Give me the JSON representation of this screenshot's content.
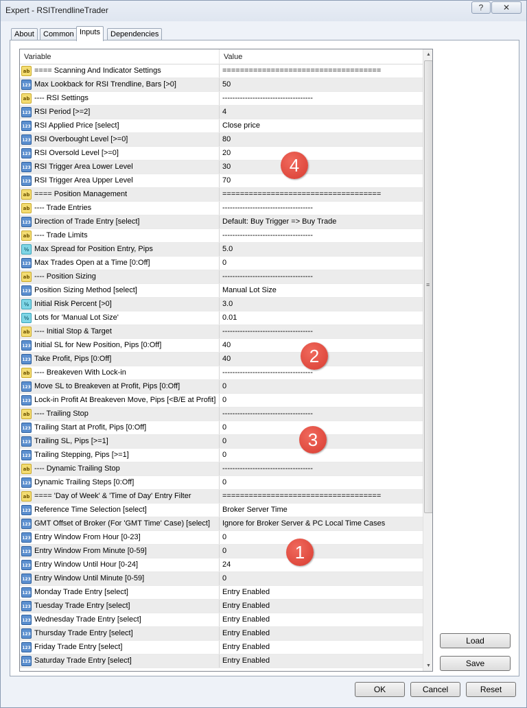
{
  "window": {
    "title": "Expert - RSITrendlineTrader",
    "help_label": "?",
    "close_label": "✕"
  },
  "tabs": [
    {
      "label": "About",
      "active": false
    },
    {
      "label": "Common",
      "active": false
    },
    {
      "label": "Inputs",
      "active": true
    },
    {
      "label": "Dependencies",
      "active": false
    }
  ],
  "grid": {
    "columns": {
      "variable": "Variable",
      "value": "Value"
    },
    "rows": [
      {
        "icon": "ab",
        "variable": "==== Scanning And Indicator Settings",
        "value": "===================================="
      },
      {
        "icon": "123",
        "variable": "Max Lookback for RSI Trendline, Bars [>0]",
        "value": "50"
      },
      {
        "icon": "ab",
        "variable": "---- RSI Settings",
        "value": "------------------------------------"
      },
      {
        "icon": "123",
        "variable": "RSI Period [>=2]",
        "value": "4"
      },
      {
        "icon": "123",
        "variable": "RSI Applied Price [select]",
        "value": "Close price"
      },
      {
        "icon": "123",
        "variable": "RSI Overbought Level [>=0]",
        "value": "80"
      },
      {
        "icon": "123",
        "variable": "RSI Oversold Level [>=0]",
        "value": "20"
      },
      {
        "icon": "123",
        "variable": "RSI Trigger Area Lower Level",
        "value": "30"
      },
      {
        "icon": "123",
        "variable": "RSI Trigger Area Upper Level",
        "value": "70"
      },
      {
        "icon": "ab",
        "variable": "==== Position Management",
        "value": "===================================="
      },
      {
        "icon": "ab",
        "variable": "---- Trade Entries",
        "value": "------------------------------------"
      },
      {
        "icon": "123",
        "variable": "Direction of Trade Entry [select]",
        "value": "Default: Buy Trigger => Buy Trade"
      },
      {
        "icon": "ab",
        "variable": "---- Trade Limits",
        "value": "------------------------------------"
      },
      {
        "icon": "half",
        "variable": "Max Spread for Position Entry, Pips",
        "value": "5.0"
      },
      {
        "icon": "123",
        "variable": "Max Trades Open at a Time [0:Off]",
        "value": "0"
      },
      {
        "icon": "ab",
        "variable": "---- Position Sizing",
        "value": "------------------------------------"
      },
      {
        "icon": "123",
        "variable": "Position Sizing Method [select]",
        "value": "Manual Lot Size"
      },
      {
        "icon": "half",
        "variable": "Initial Risk Percent [>0]",
        "value": "3.0"
      },
      {
        "icon": "half",
        "variable": "Lots for 'Manual Lot Size'",
        "value": "0.01"
      },
      {
        "icon": "ab",
        "variable": "---- Initial Stop & Target",
        "value": "------------------------------------"
      },
      {
        "icon": "123",
        "variable": "Initial SL for New Position, Pips [0:Off]",
        "value": "40"
      },
      {
        "icon": "123",
        "variable": "Take Profit, Pips [0:Off]",
        "value": "40"
      },
      {
        "icon": "ab",
        "variable": "---- Breakeven With Lock-in",
        "value": "------------------------------------"
      },
      {
        "icon": "123",
        "variable": "Move SL to Breakeven at Profit, Pips [0:Off]",
        "value": "0"
      },
      {
        "icon": "123",
        "variable": "Lock-in Profit At Breakeven Move, Pips [<B/E at Profit]",
        "value": "0"
      },
      {
        "icon": "ab",
        "variable": "---- Trailing Stop",
        "value": "------------------------------------"
      },
      {
        "icon": "123",
        "variable": "Trailing Start at Profit, Pips [0:Off]",
        "value": "0"
      },
      {
        "icon": "123",
        "variable": "Trailing SL, Pips [>=1]",
        "value": "0"
      },
      {
        "icon": "123",
        "variable": "Trailing Stepping, Pips [>=1]",
        "value": "0"
      },
      {
        "icon": "ab",
        "variable": "---- Dynamic Trailing Stop",
        "value": "------------------------------------"
      },
      {
        "icon": "123",
        "variable": "Dynamic Trailing Steps [0:Off]",
        "value": "0"
      },
      {
        "icon": "ab",
        "variable": "==== 'Day of Week' & 'Time of Day' Entry Filter",
        "value": "===================================="
      },
      {
        "icon": "123",
        "variable": "Reference Time Selection [select]",
        "value": "Broker Server Time"
      },
      {
        "icon": "123",
        "variable": "GMT Offset of Broker (For 'GMT Time' Case) [select]",
        "value": "Ignore for Broker Server & PC Local Time Cases"
      },
      {
        "icon": "123",
        "variable": "Entry Window From Hour [0-23]",
        "value": "0"
      },
      {
        "icon": "123",
        "variable": "Entry Window From Minute [0-59]",
        "value": "0"
      },
      {
        "icon": "123",
        "variable": "Entry Window Until Hour [0-24]",
        "value": "24"
      },
      {
        "icon": "123",
        "variable": "Entry Window Until Minute [0-59]",
        "value": "0"
      },
      {
        "icon": "123",
        "variable": "Monday Trade Entry [select]",
        "value": "Entry Enabled"
      },
      {
        "icon": "123",
        "variable": "Tuesday Trade Entry [select]",
        "value": "Entry Enabled"
      },
      {
        "icon": "123",
        "variable": "Wednesday Trade Entry [select]",
        "value": "Entry Enabled"
      },
      {
        "icon": "123",
        "variable": "Thursday Trade Entry [select]",
        "value": "Entry Enabled"
      },
      {
        "icon": "123",
        "variable": "Friday Trade Entry [select]",
        "value": "Entry Enabled"
      },
      {
        "icon": "123",
        "variable": "Saturday Trade Entry [select]",
        "value": "Entry Enabled"
      }
    ]
  },
  "annotations": [
    {
      "label": "4"
    },
    {
      "label": "2"
    },
    {
      "label": "3"
    },
    {
      "label": "1"
    }
  ],
  "side_buttons": {
    "load": "Load",
    "save": "Save"
  },
  "footer_buttons": {
    "ok": "OK",
    "cancel": "Cancel",
    "reset": "Reset"
  },
  "icons": {
    "ab": "string-icon",
    "123": "integer-icon",
    "half": "double-icon"
  },
  "colors": {
    "badge": "#d83c31",
    "alt_row": "#ececec",
    "window_bg": "#eef2f8"
  }
}
